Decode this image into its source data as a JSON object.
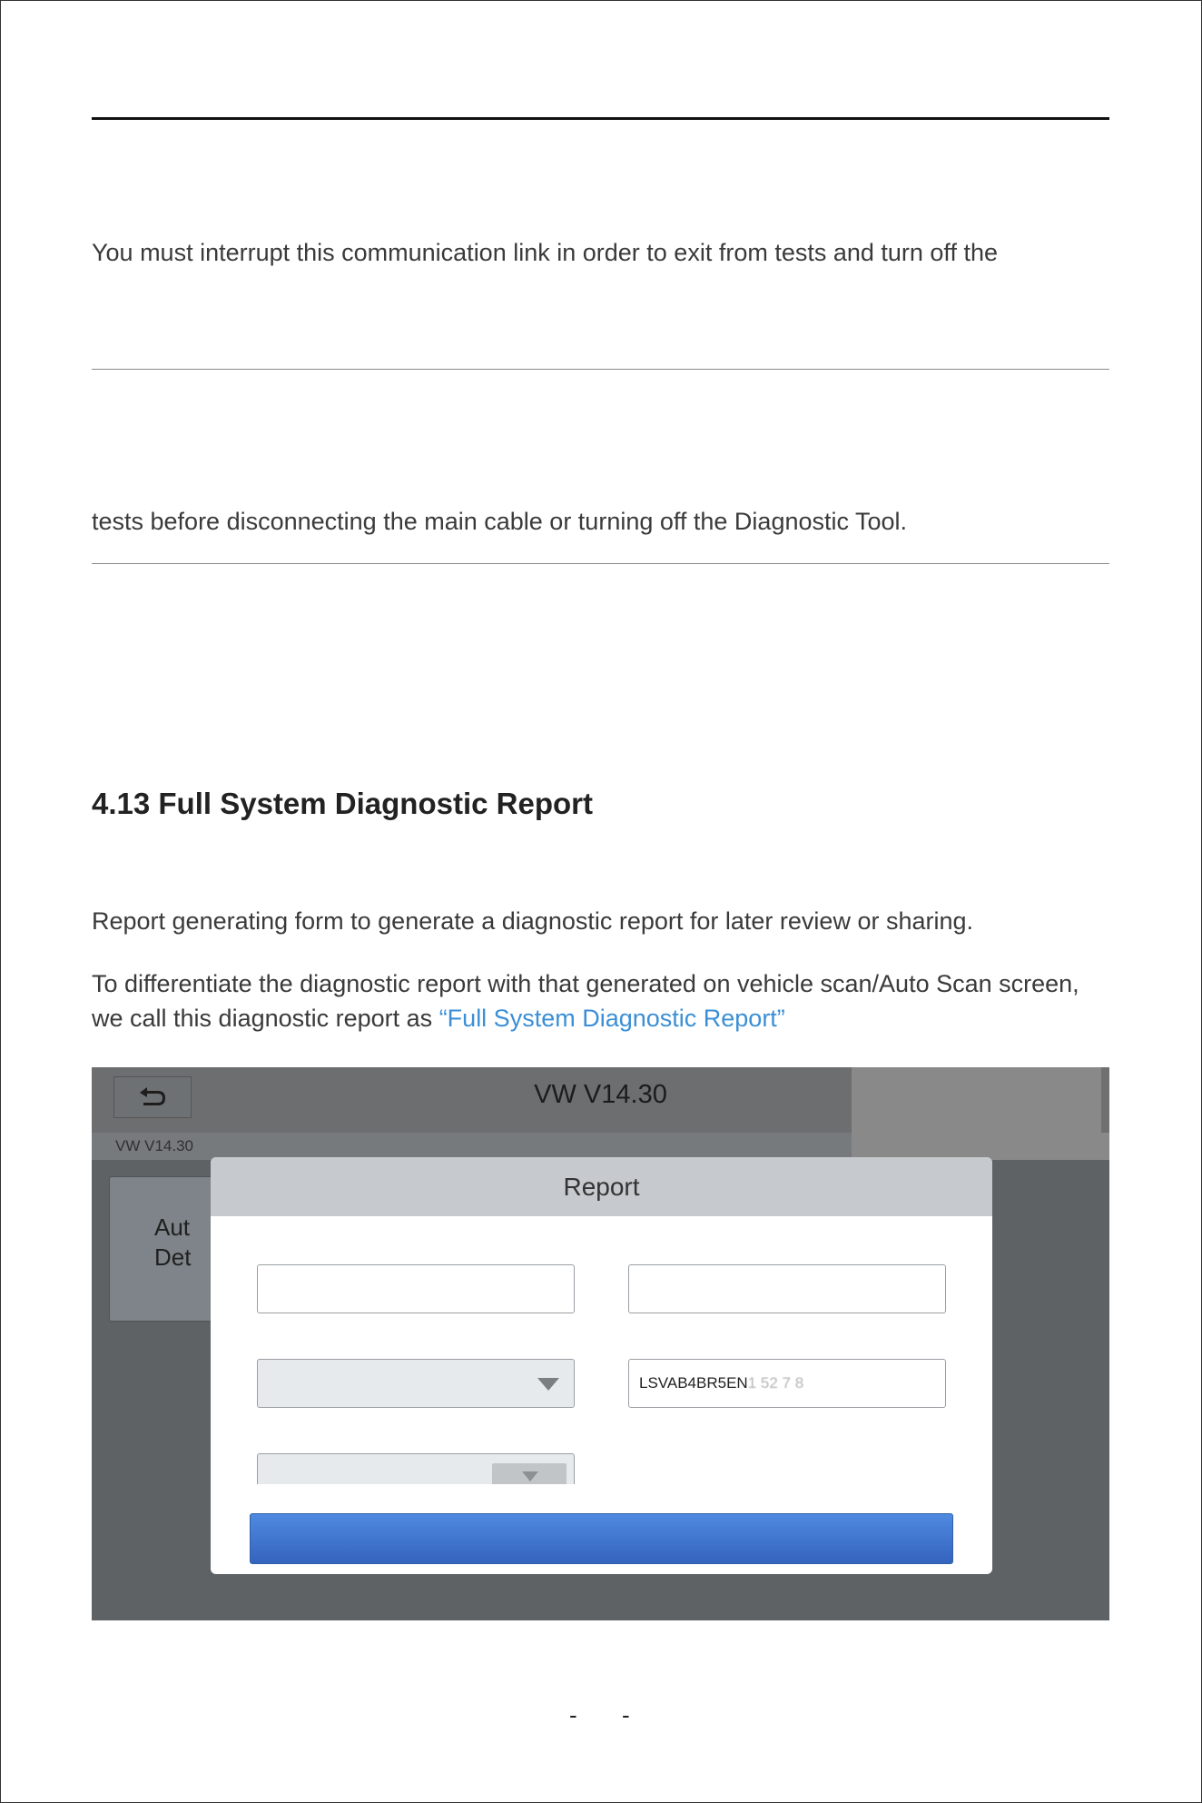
{
  "body": {
    "line_top": "You must interrupt this communication link in order to exit from tests and turn off the",
    "line_tests": "tests before disconnecting the main cable or turning off the Diagnostic Tool."
  },
  "section": {
    "heading": "4.13 Full System Diagnostic Report",
    "para1": "Report generating form to generate a diagnostic report for later review or sharing.",
    "para2_line1": "To differentiate the diagnostic report with that generated on vehicle scan/Auto Scan screen,",
    "para2_line2_prefix": "we call this diagnostic report as ",
    "para2_link": "“Full System Diagnostic Report”"
  },
  "screenshot": {
    "app_title": "VW V14.30",
    "breadcrumb": "VW V14.30",
    "background_card": {
      "line1": "Aut",
      "line2": "Det"
    },
    "dialog": {
      "title": "Report",
      "vin_visible": "LSVAB4BR5EN",
      "vin_obscured": "1 52 7 8"
    },
    "icons": {
      "back": "back-arrow-icon",
      "dropdown": "chevron-down-icon"
    },
    "colors": {
      "accent_button": "#3f74cf",
      "link": "#3b8fd6"
    }
  },
  "footer": {
    "dash_left": "-",
    "dash_right": "-"
  }
}
